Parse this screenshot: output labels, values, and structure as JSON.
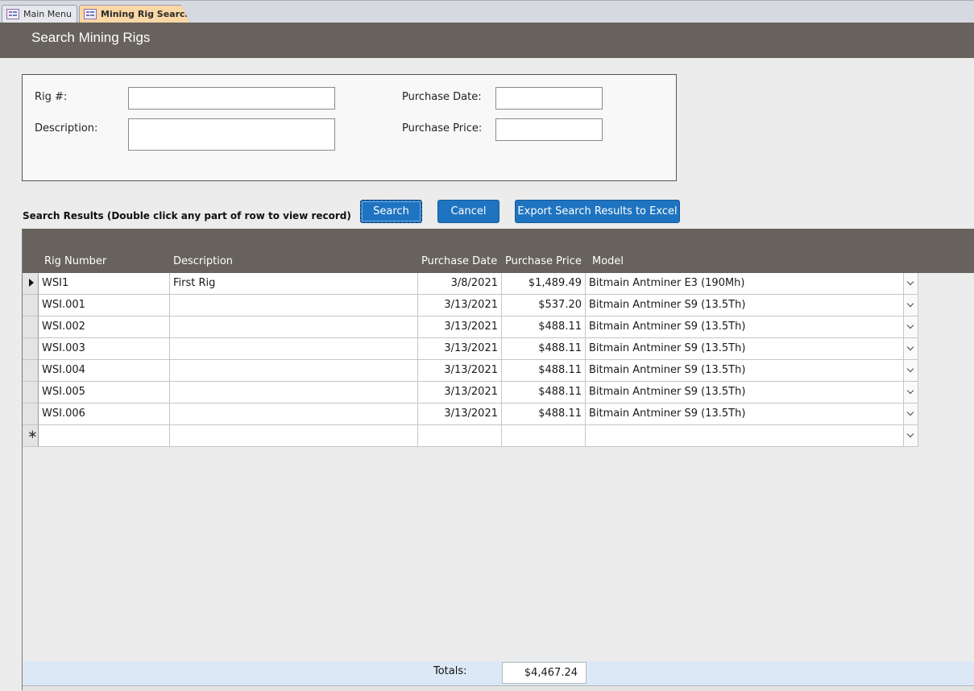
{
  "tabs": [
    {
      "label": "Main Menu",
      "active": false
    },
    {
      "label": "Mining Rig Search",
      "active": true
    }
  ],
  "header": {
    "title": "Search Mining Rigs"
  },
  "criteria": {
    "rig_label": "Rig #:",
    "description_label": "Description:",
    "purchase_date_label": "Purchase Date:",
    "purchase_price_label": "Purchase Price:",
    "rig_value": "",
    "description_value": "",
    "purchase_date_value": "",
    "purchase_price_value": ""
  },
  "results_caption": "Search Results (Double click any part of row to view record)",
  "buttons": {
    "search": "Search",
    "cancel": "Cancel",
    "export": "Export Search Results to Excel"
  },
  "columns": [
    "Rig Number",
    "Description",
    "Purchase Date",
    "Purchase Price",
    "Model"
  ],
  "rows": [
    {
      "rig": "WSI1",
      "description": "First Rig",
      "date": "3/8/2021",
      "price": "$1,489.49",
      "model": "Bitmain Antminer E3 (190Mh)"
    },
    {
      "rig": "WSI.001",
      "description": "",
      "date": "3/13/2021",
      "price": "$537.20",
      "model": "Bitmain Antminer S9 (13.5Th)"
    },
    {
      "rig": "WSI.002",
      "description": "",
      "date": "3/13/2021",
      "price": "$488.11",
      "model": "Bitmain Antminer S9 (13.5Th)"
    },
    {
      "rig": "WSI.003",
      "description": "",
      "date": "3/13/2021",
      "price": "$488.11",
      "model": "Bitmain Antminer S9 (13.5Th)"
    },
    {
      "rig": "WSI.004",
      "description": "",
      "date": "3/13/2021",
      "price": "$488.11",
      "model": "Bitmain Antminer S9 (13.5Th)"
    },
    {
      "rig": "WSI.005",
      "description": "",
      "date": "3/13/2021",
      "price": "$488.11",
      "model": "Bitmain Antminer S9 (13.5Th)"
    },
    {
      "rig": "WSI.006",
      "description": "",
      "date": "3/13/2021",
      "price": "$488.11",
      "model": "Bitmain Antminer S9 (13.5Th)"
    }
  ],
  "totals": {
    "label": "Totals:",
    "value": "$4,467.24"
  },
  "colors": {
    "header_bg": "#67625c",
    "button_bg": "#1f74c1",
    "active_tab": "#fbd7a6",
    "totals_bg": "#dce8f6"
  },
  "icons": {
    "tab_icon": "form-icon",
    "current_record": "record-pointer-icon",
    "new_record": "new-record-icon",
    "dropdown": "chevron-down-icon"
  }
}
